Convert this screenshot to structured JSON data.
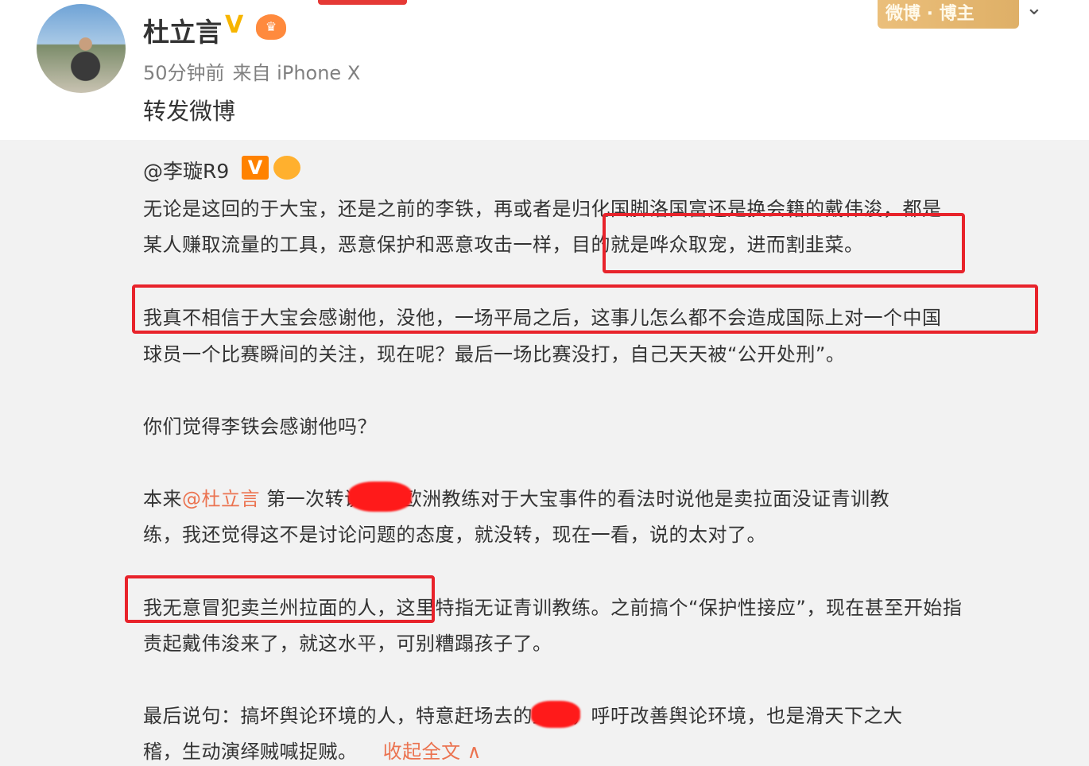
{
  "post": {
    "author": "杜立言",
    "time": "50分钟前",
    "source": "来自 iPhone X",
    "repost_label": "转发微博",
    "badge_text": "微博 · 博主",
    "collapse_icon": "chevron-down-icon",
    "verified_icon": "verified-v-icon",
    "member_icon": "crown-icon"
  },
  "original": {
    "author": "@李璇R9",
    "verified": "V",
    "lines": {
      "l1": "无论是这回的于大宝，还是之前的李铁，再或者是归化国脚洛国富还是换会籍的戴伟浚，都是",
      "l2": "某人赚取流量的工具，恶意保护和恶意攻击一样，目的就是哗众取宠，进而割韭菜。",
      "l3": "我真不相信于大宝会感谢他，没他，一场平局之后，这事儿怎么都不会造成国际上对一个中国",
      "l4": "球员一个比赛瞬间的关注，现在呢？最后一场比赛没打，自己天天被“公开处刑”。",
      "l5": "你们觉得李铁会感谢他吗？",
      "l6_prefix": "本来",
      "l6_mention": "@杜立言",
      "l6_rest": " 第一次转说两位欧洲教练对于大宝事件的看法时说他是卖拉面没证青训教",
      "l7": "练，我还觉得这不是讨论问题的态度，就没转，现在一看，说的太对了。",
      "l8": "我无意冒犯卖兰州拉面的人，这里特指无证青训教练。之前搞个“保护性接应”，现在甚至开始指",
      "l9": "责起戴伟浚来了，就这水平，可别糟蹋孩子了。",
      "l10": "最后说句：搞坏舆论环境的人，特意赶场去的直播，呼吁改善舆论环境，也是滑天下之大",
      "l11_text": "稽，生动演绎贼喊捉贼。",
      "l11_fold": "收起全文 ∧"
    }
  },
  "colors": {
    "mention": "#eb7350",
    "highlight_box": "#e8232b",
    "repost_bg": "#f2f2f2"
  }
}
